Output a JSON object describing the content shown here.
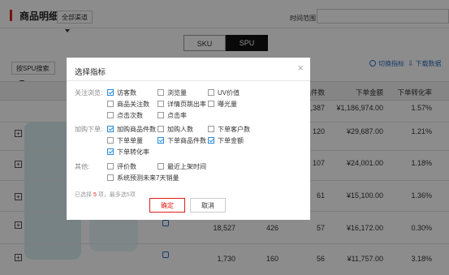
{
  "header": {
    "title": "商品明细",
    "channel_select": "全部渠道",
    "time_label": "时间范围"
  },
  "tabs": [
    {
      "label": "SKU",
      "active": false
    },
    {
      "label": "SPU",
      "active": true
    }
  ],
  "toolbar": {
    "search_type": "按SPU搜索",
    "switch_metrics": "切换指标",
    "download": "下载数据"
  },
  "table": {
    "headers": [
      "品件数",
      "下单金额",
      "下单转化率"
    ],
    "rows": [
      {
        "c1": "",
        "c2": "",
        "c3": "1,387",
        "amount": "¥1,186,974.00",
        "rate": "1.57%"
      },
      {
        "c1": "",
        "c2": "",
        "c3": "120",
        "amount": "¥29,687.00",
        "rate": "1.21%"
      },
      {
        "c1": "",
        "c2": "",
        "c3": "107",
        "amount": "¥24,001.00",
        "rate": "1.18%"
      },
      {
        "c1": "",
        "c2": "",
        "c3": "61",
        "amount": "¥15,100.00",
        "rate": "1.36%"
      },
      {
        "c1": "18,527",
        "c2": "426",
        "c3": "57",
        "amount": "¥16,172.00",
        "rate": "0.30%"
      },
      {
        "c1": "1,730",
        "c2": "160",
        "c3": "56",
        "amount": "¥11,757.00",
        "rate": "3.18%"
      }
    ]
  },
  "modal": {
    "title": "选择指标",
    "close": "×",
    "groups": [
      {
        "label": "关注浏览:",
        "items": [
          {
            "label": "访客数",
            "checked": true
          },
          {
            "label": "浏览量",
            "checked": false
          },
          {
            "label": "UV价值",
            "checked": false
          },
          {
            "label": "商品关注数",
            "checked": false
          },
          {
            "label": "详情页跳出率",
            "checked": false
          },
          {
            "label": "曝光量",
            "checked": false
          },
          {
            "label": "点击次数",
            "checked": false
          },
          {
            "label": "点击率",
            "checked": false
          }
        ]
      },
      {
        "label": "加购下单:",
        "items": [
          {
            "label": "加购商品件数",
            "checked": true
          },
          {
            "label": "加购人数",
            "checked": false
          },
          {
            "label": "下单客户数",
            "checked": false
          },
          {
            "label": "下单单量",
            "checked": false
          },
          {
            "label": "下单商品件数",
            "checked": true
          },
          {
            "label": "下单金额",
            "checked": true
          },
          {
            "label": "下单转化率",
            "checked": true
          }
        ]
      },
      {
        "label": "其他:",
        "items": [
          {
            "label": "评价数",
            "checked": false
          },
          {
            "label": "最近上架时间",
            "checked": false
          },
          {
            "label": "系统预测未来7天销量",
            "checked": false
          }
        ]
      }
    ],
    "selected_prefix": "已选择 ",
    "selected_count": "5",
    "selected_suffix": " 项，最多选5项",
    "confirm": "确定",
    "cancel": "取消"
  },
  "colors": {
    "accent": "#e0211b",
    "link": "#2b6dbf",
    "check": "#2a8ad8"
  }
}
